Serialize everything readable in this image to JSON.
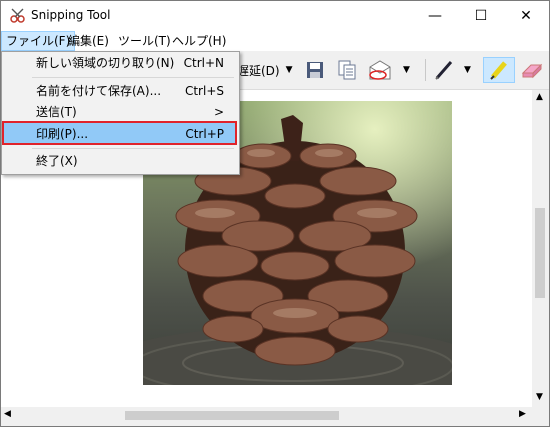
{
  "window": {
    "title": "Snipping Tool",
    "controls": {
      "minimize": "—",
      "maximize": "☐",
      "close": "✕"
    }
  },
  "menubar": {
    "items": [
      "ファイル(F)",
      "編集(E)",
      "ツール(T)",
      "ヘルプ(H)"
    ]
  },
  "toolbar": {
    "delay_label": "遅延(D)",
    "buttons": [
      "delay",
      "save-icon",
      "copy-icon",
      "send-email-icon",
      "pen-icon",
      "highlighter-icon",
      "eraser-icon"
    ],
    "pressed": "highlighter-icon"
  },
  "file_menu": {
    "items": [
      {
        "label": "新しい領域の切り取り(N)",
        "shortcut": "Ctrl+N"
      },
      {
        "label": "名前を付けて保存(A)...",
        "shortcut": "Ctrl+S"
      },
      {
        "label": "送信(T)",
        "shortcut": "",
        "submenu": ">"
      },
      {
        "label": "印刷(P)...",
        "shortcut": "Ctrl+P",
        "highlighted": true
      },
      {
        "label": "終了(X)",
        "shortcut": ""
      }
    ]
  },
  "colors": {
    "highlight": "#91c9f7",
    "red_annotation": "#e0232b",
    "active_menu": "#cce8ff"
  }
}
